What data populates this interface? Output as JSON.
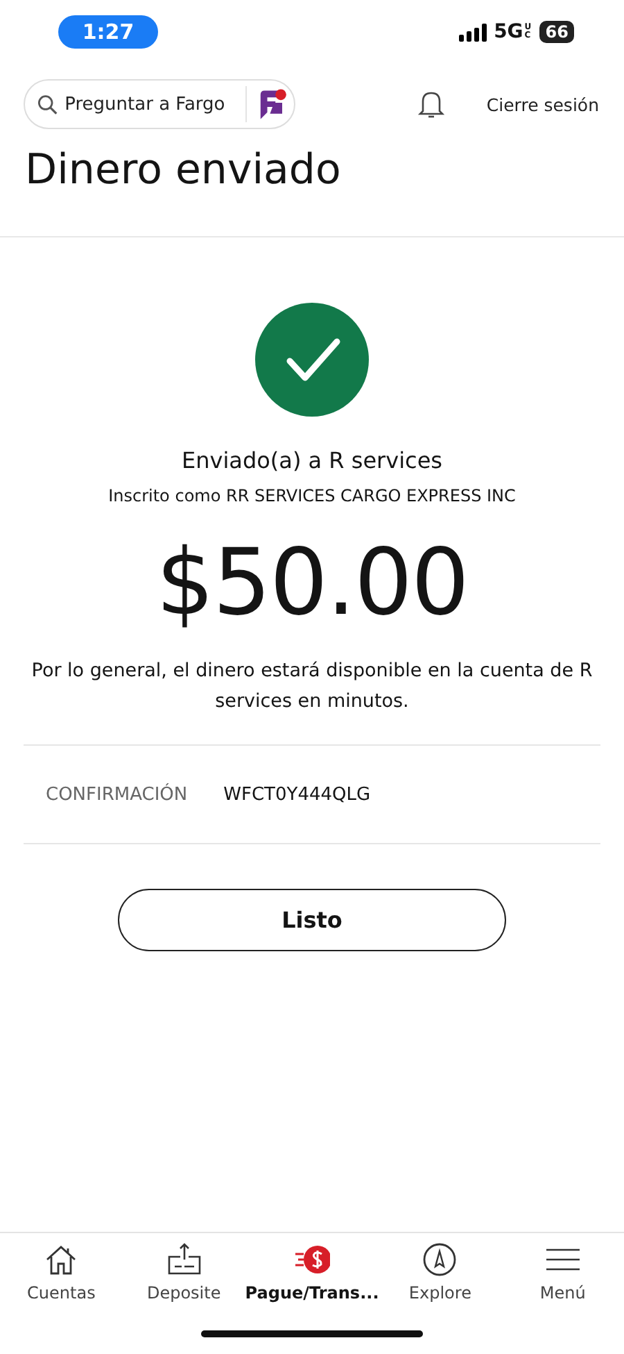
{
  "status_bar": {
    "time": "1:27",
    "network": "5G",
    "network_badge": "UC",
    "battery": "66"
  },
  "header": {
    "search": {
      "placeholder": "Preguntar a Fargo"
    },
    "logout": "Cierre sesión"
  },
  "title": "Dinero enviado",
  "result": {
    "recipient": "Enviado(a) a R services",
    "enrolled": "Inscrito como RR SERVICES CARGO EXPRESS INC",
    "amount": "$50.00",
    "note": "Por lo general, el dinero estará disponible en la cuenta de R services en minutos."
  },
  "confirmation": {
    "label": "CONFIRMACIÓN",
    "value": "WFCT0Y444QLG"
  },
  "done_button": "Listo",
  "tabs": [
    {
      "kind": "home",
      "label": "Cuentas",
      "selected": false
    },
    {
      "kind": "deposit",
      "label": "Deposite",
      "selected": false
    },
    {
      "kind": "pay",
      "label": "Pague/Trans...",
      "selected": true
    },
    {
      "kind": "explore",
      "label": "Explore",
      "selected": false
    },
    {
      "kind": "menu",
      "label": "Menú",
      "selected": false
    }
  ]
}
